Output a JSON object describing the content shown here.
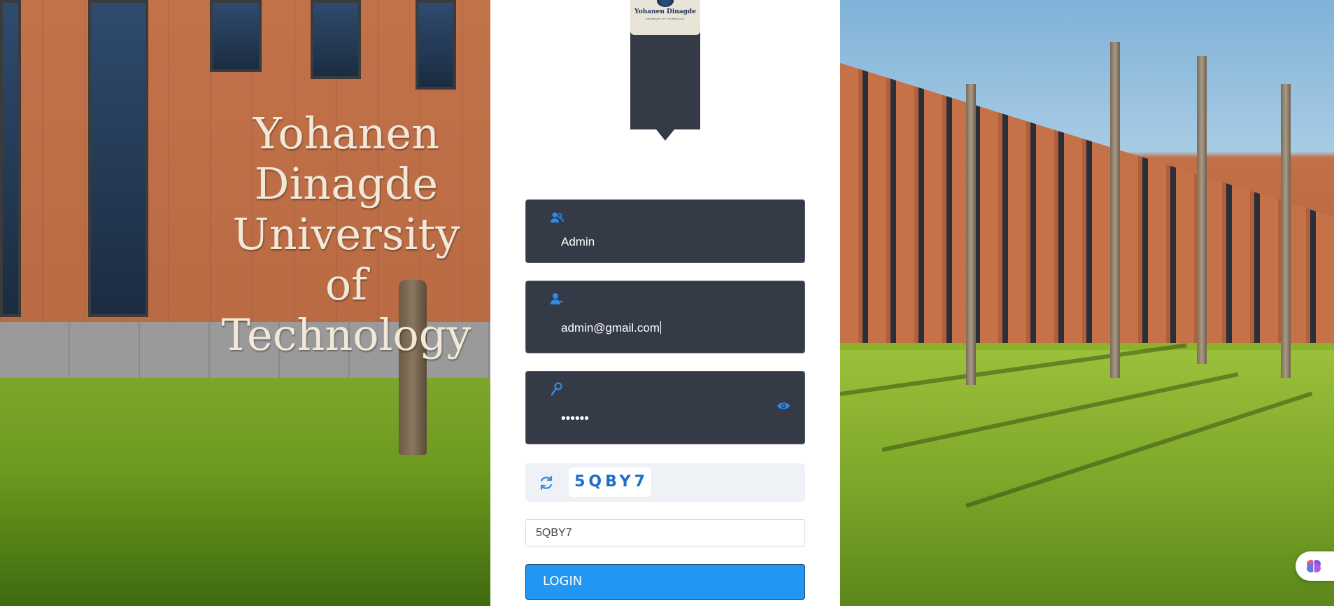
{
  "background": {
    "sign_text": [
      "Yohanen Dinagde",
      "University",
      "of Technology"
    ]
  },
  "logo": {
    "name": "Yohanen Dinagde",
    "subtitle": "UNIVERSITY OF TECHNOLOGY"
  },
  "form": {
    "role_field": {
      "value": "Admin",
      "icon": "users-icon"
    },
    "email_field": {
      "value": "admin@gmail.com",
      "icon": "user-icon"
    },
    "password_field": {
      "value": "••••••",
      "icon": "key-icon",
      "toggle_icon": "eye-icon"
    },
    "captcha": {
      "code": "5QBY7",
      "refresh_icon": "refresh-icon"
    },
    "captcha_input": {
      "value": "5QBY7"
    },
    "login_label": "LOGIN"
  },
  "widget": {
    "icon": "brain-icon"
  },
  "colors": {
    "accent": "#2196f3",
    "field_bg": "#353b46",
    "icon_blue": "#2b8cea"
  }
}
